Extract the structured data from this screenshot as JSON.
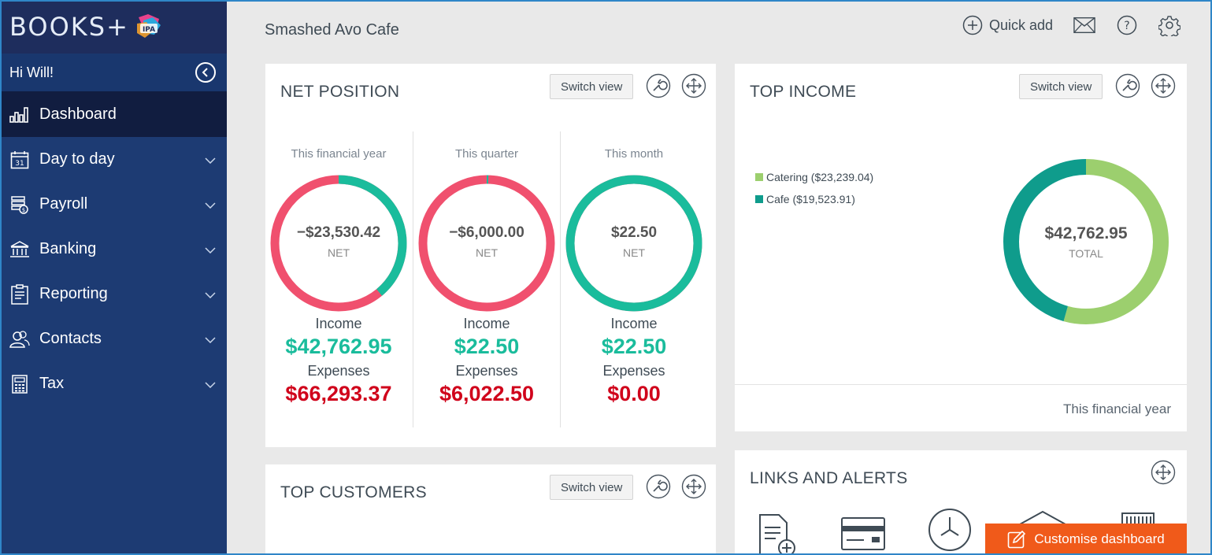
{
  "sidebar": {
    "brand": "BOOKS+",
    "brand_badge": "IPA",
    "greeting": "Hi Will!",
    "items": [
      {
        "label": "Dashboard",
        "icon": "bar-chart-icon",
        "active": true
      },
      {
        "label": "Day to day",
        "icon": "calendar-icon",
        "calendar_number": "31"
      },
      {
        "label": "Payroll",
        "icon": "payroll-icon"
      },
      {
        "label": "Banking",
        "icon": "bank-icon"
      },
      {
        "label": "Reporting",
        "icon": "clipboard-icon"
      },
      {
        "label": "Contacts",
        "icon": "contacts-icon"
      },
      {
        "label": "Tax",
        "icon": "calculator-icon"
      }
    ]
  },
  "topbar": {
    "company": "Smashed Avo Cafe",
    "quick_add": "Quick add"
  },
  "net_position": {
    "title": "NET POSITION",
    "switch_view": "Switch view",
    "columns": [
      {
        "period": "This financial year",
        "net": "−$23,530.42",
        "net_label": "NET",
        "income_label": "Income",
        "income": "$42,762.95",
        "expenses_label": "Expenses",
        "expenses": "$66,293.37",
        "income_fraction": 0.39
      },
      {
        "period": "This quarter",
        "net": "−$6,000.00",
        "net_label": "NET",
        "income_label": "Income",
        "income": "$22.50",
        "expenses_label": "Expenses",
        "expenses": "$6,022.50",
        "income_fraction": 0.004
      },
      {
        "period": "This month",
        "net": "$22.50",
        "net_label": "NET",
        "income_label": "Income",
        "income": "$22.50",
        "expenses_label": "Expenses",
        "expenses": "$0.00",
        "income_fraction": 1.0
      }
    ]
  },
  "top_income": {
    "title": "TOP INCOME",
    "switch_view": "Switch view",
    "legend": [
      {
        "label": "Catering ($23,239.04)",
        "color": "#9ccf6e",
        "value": 23239.04
      },
      {
        "label": "Cafe ($19,523.91)",
        "color": "#0f9c8c",
        "value": 19523.91
      }
    ],
    "total": "$42,762.95",
    "total_label": "TOTAL",
    "period": "This financial year"
  },
  "top_customers": {
    "title": "TOP CUSTOMERS",
    "switch_view": "Switch view"
  },
  "links_alerts": {
    "title": "LINKS AND ALERTS"
  },
  "customise": {
    "label": "Customise dashboard"
  },
  "colors": {
    "income": "#1abc9c",
    "expense": "#f0506e",
    "expense_text": "#d0021b",
    "sidebar": "#1d3b73",
    "accent": "#f05a1a"
  }
}
